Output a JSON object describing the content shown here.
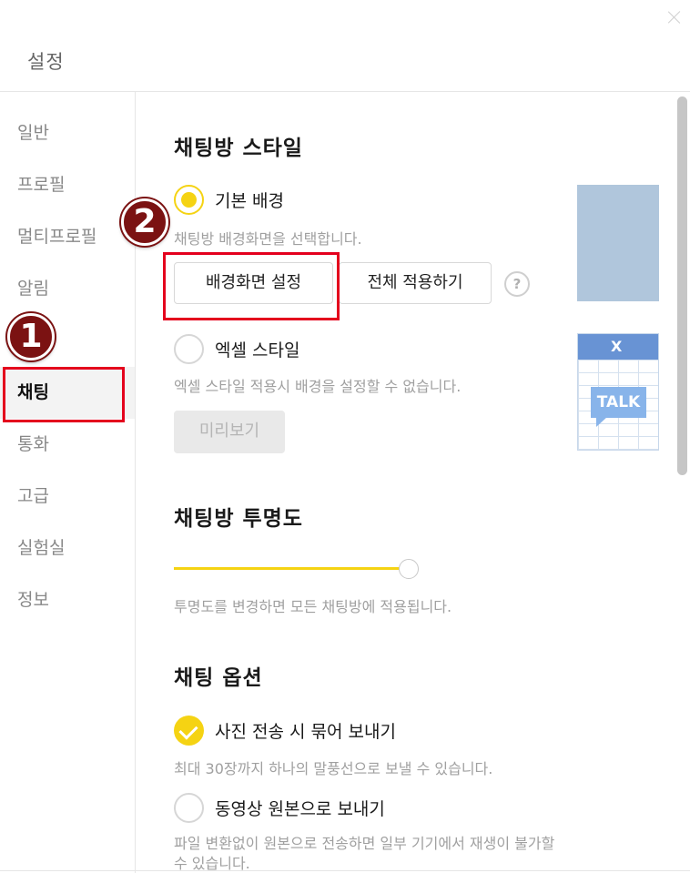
{
  "window": {
    "title": "설정"
  },
  "sidebar": {
    "items": [
      {
        "label": "일반"
      },
      {
        "label": "프로필"
      },
      {
        "label": "멀티프로필"
      },
      {
        "label": "알림"
      },
      {
        "label": "채팅",
        "active": true
      },
      {
        "label": "통화"
      },
      {
        "label": "고급"
      },
      {
        "label": "실험실"
      },
      {
        "label": "정보"
      }
    ]
  },
  "chat_style": {
    "heading": "채팅방 스타일",
    "default_bg": {
      "label": "기본 배경",
      "selected": true,
      "desc": "채팅방 배경화면을 선택합니다.",
      "set_bg_button": "배경화면 설정",
      "apply_all_button": "전체 적용하기",
      "help_icon": "?"
    },
    "excel_style": {
      "label": "엑셀 스타일",
      "selected": false,
      "desc": "엑셀 스타일 적용시 배경을 설정할 수 없습니다.",
      "preview_button": "미리보기",
      "thumb_logo": "X",
      "thumb_text": "TALK"
    }
  },
  "transparency": {
    "heading": "채팅방 투명도",
    "value_fraction": 1.0,
    "desc": "투명도를 변경하면 모든 채팅방에 적용됩니다."
  },
  "chat_options": {
    "heading": "채팅 옵션",
    "bundle_photos": {
      "label": "사진 전송 시 묶어 보내기",
      "checked": true,
      "desc": "최대 30장까지 하나의 말풍선으로 보낼 수 있습니다."
    },
    "original_video": {
      "label": "동영상 원본으로 보내기",
      "checked": false,
      "desc_line1": "파일 변환없이 원본으로 전송하면 일부 기기에서 재생이 불가할",
      "desc_line2": "수 있습니다."
    }
  },
  "annotations": {
    "badge1": "1",
    "badge2": "2"
  },
  "colors": {
    "accent": "#f5d313",
    "marker": "#e4001d",
    "badge": "#7b1212",
    "bg_thumb": "#b0c6dc"
  }
}
